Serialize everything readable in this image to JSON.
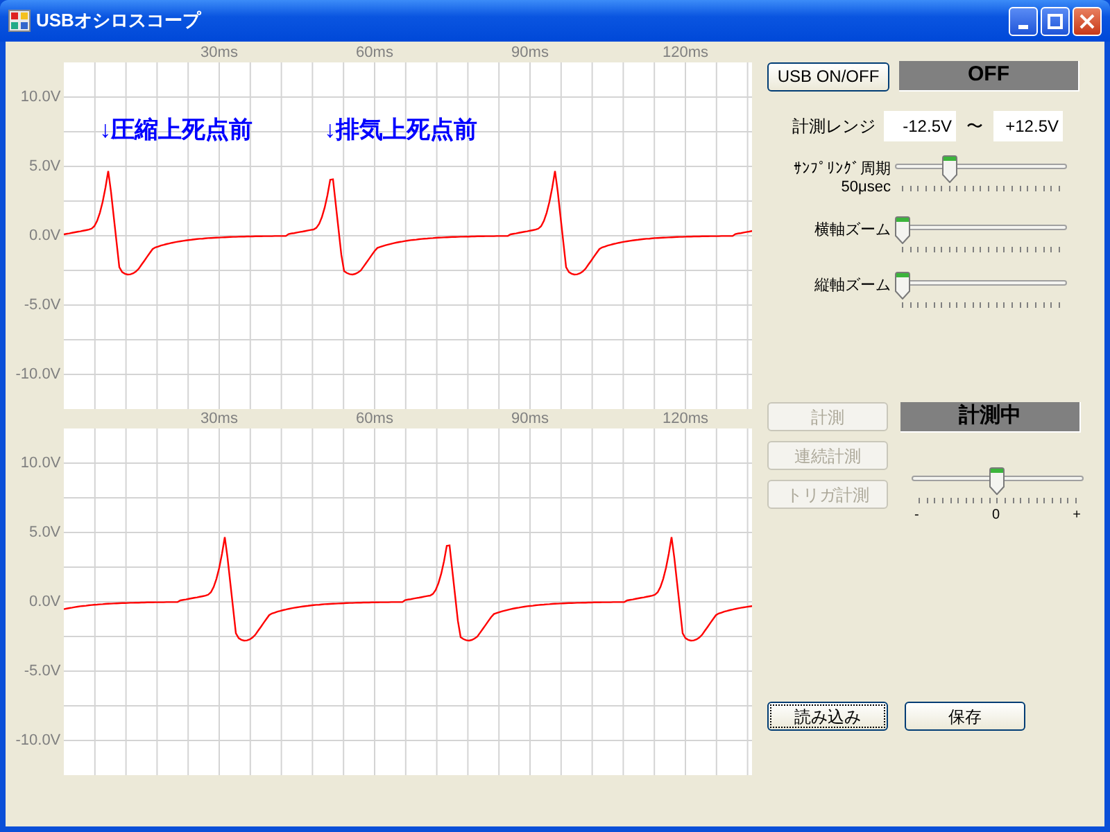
{
  "window": {
    "title": "USBオシロスコープ"
  },
  "plots": [
    {
      "time_labels": [
        "30ms",
        "60ms",
        "90ms",
        "120ms"
      ],
      "voltage_labels": [
        "10.0V",
        "5.0V",
        "0.0V",
        "-5.0V",
        "-10.0V"
      ],
      "annotations": [
        "↓圧縮上死点前",
        "↓排気上死点前"
      ]
    },
    {
      "time_labels": [
        "30ms",
        "60ms",
        "90ms",
        "120ms"
      ],
      "voltage_labels": [
        "10.0V",
        "5.0V",
        "0.0V",
        "-5.0V",
        "-10.0V"
      ]
    }
  ],
  "controls": {
    "usb_button": "USB ON/OFF",
    "usb_status": "OFF",
    "range_label": "計測レンジ",
    "range_min": "-12.5V",
    "range_separator": "〜",
    "range_max": "+12.5V",
    "sliders": [
      {
        "label": "ｻﾝﾌﾟﾘﾝｸﾞ周期",
        "sublabel": "50μsec",
        "level": 0.3
      },
      {
        "label": "横軸ズーム",
        "level": 0
      },
      {
        "label": "縦軸ズーム",
        "level": 0
      }
    ]
  },
  "measure": {
    "buttons": [
      {
        "label": "計測",
        "disabled": true
      },
      {
        "label": "連続計測",
        "disabled": true
      },
      {
        "label": "トリガ計測",
        "disabled": true
      }
    ],
    "status": "計測中",
    "trigger_slider": {
      "level": 0.5,
      "min_label": "-",
      "mid_label": "0",
      "max_label": "+"
    }
  },
  "footer_buttons": [
    {
      "label": "読み込み",
      "focused": true
    },
    {
      "label": "保存",
      "focused": false
    }
  ]
}
